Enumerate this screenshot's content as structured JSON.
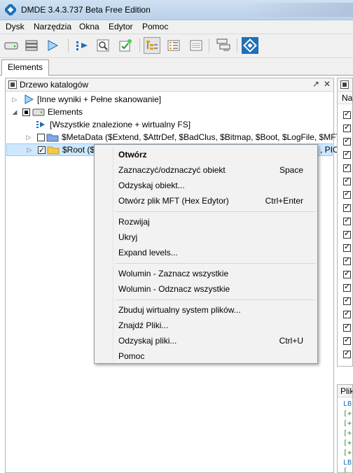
{
  "window": {
    "title": "DMDE 3.4.3.737 Beta Free Edition"
  },
  "menu": [
    "Dysk",
    "Narzędzia",
    "Okna",
    "Edytor",
    "Pomoc"
  ],
  "tabs": {
    "active": "Elements"
  },
  "tree_panel": {
    "title": "Drzewo katalogów",
    "rows": [
      {
        "label": "[Inne wyniki + Pełne skanowanie]"
      },
      {
        "label": "Elements"
      },
      {
        "label": "[Wszystkie znalezione + wirtualny FS]"
      },
      {
        "label": "$MetaData ($Extend, $AttrDef, $BadClus, $Bitmap, $Boot, $LogFile, $MFT,"
      },
      {
        "label": "$Root ($l",
        "tail": ", PIC"
      }
    ]
  },
  "right_panel": {
    "header": "Na",
    "lower_header": "Plik"
  },
  "log_lines": [
    "LB",
    "[+",
    "[+",
    "[+",
    "[+",
    "[+",
    "LB",
    "["
  ],
  "context_menu": {
    "items": [
      {
        "label": "Otwórz",
        "shortcut": ""
      },
      {
        "label": "Zaznaczyć/odznaczyć obiekt",
        "shortcut": "Space"
      },
      {
        "label": "Odzyskaj obiekt...",
        "shortcut": ""
      },
      {
        "label": "Otwórz plik MFT (Hex Edytor)",
        "shortcut": "Ctrl+Enter"
      },
      {
        "label": "Rozwijaj",
        "shortcut": ""
      },
      {
        "label": "Ukryj",
        "shortcut": ""
      },
      {
        "label": "Expand levels...",
        "shortcut": ""
      },
      {
        "label": "Wolumin - Zaznacz wszystkie",
        "shortcut": ""
      },
      {
        "label": "Wolumin - Odznacz wszystkie",
        "shortcut": ""
      },
      {
        "label": "Zbuduj wirtualny system plików...",
        "shortcut": ""
      },
      {
        "label": "Znajdź Pliki...",
        "shortcut": ""
      },
      {
        "label": "Odzyskaj pliki...",
        "shortcut": "Ctrl+U"
      },
      {
        "label": "Pomoc",
        "shortcut": ""
      }
    ]
  },
  "colors": {
    "selection": "#cde8ff",
    "accent": "#1e6fb8",
    "log_green": "#2e8b2e"
  }
}
